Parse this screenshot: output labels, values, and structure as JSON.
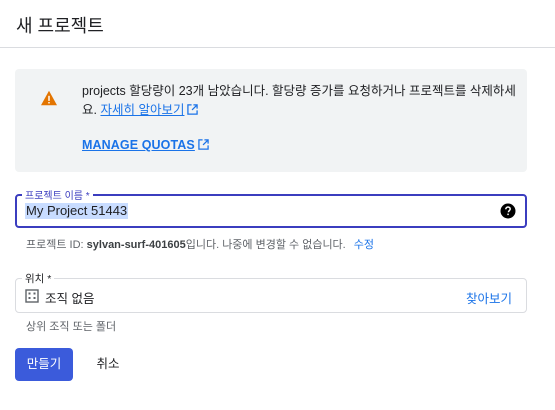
{
  "page": {
    "title": "새 프로젝트"
  },
  "notice": {
    "message": "projects 할당량이 23개 남았습니다. 할당량 증가를 요청하거나 프로젝트를 삭제하세요.",
    "learn_more": "자세히 알아보기",
    "manage_quotas": "MANAGE QUOTAS",
    "icon": "warning-icon",
    "icon_color": "#e37400"
  },
  "project_name": {
    "label": "프로젝트 이름 *",
    "value": "My Project 51443",
    "help_icon": "help-icon"
  },
  "project_id": {
    "prefix": "프로젝트 ID: ",
    "id": "sylvan-surf-401605",
    "suffix": "입니다. 나중에 변경할 수 없습니다.",
    "edit_label": "수정"
  },
  "location": {
    "label": "위치 *",
    "value": "조직 없음",
    "browse_label": "찾아보기",
    "hint": "상위 조직 또는 폴더",
    "icon": "building-icon"
  },
  "actions": {
    "create_label": "만들기",
    "cancel_label": "취소"
  },
  "colors": {
    "accent": "#3b5bdb",
    "link": "#1a73e8",
    "focus": "#3b3dbf"
  }
}
